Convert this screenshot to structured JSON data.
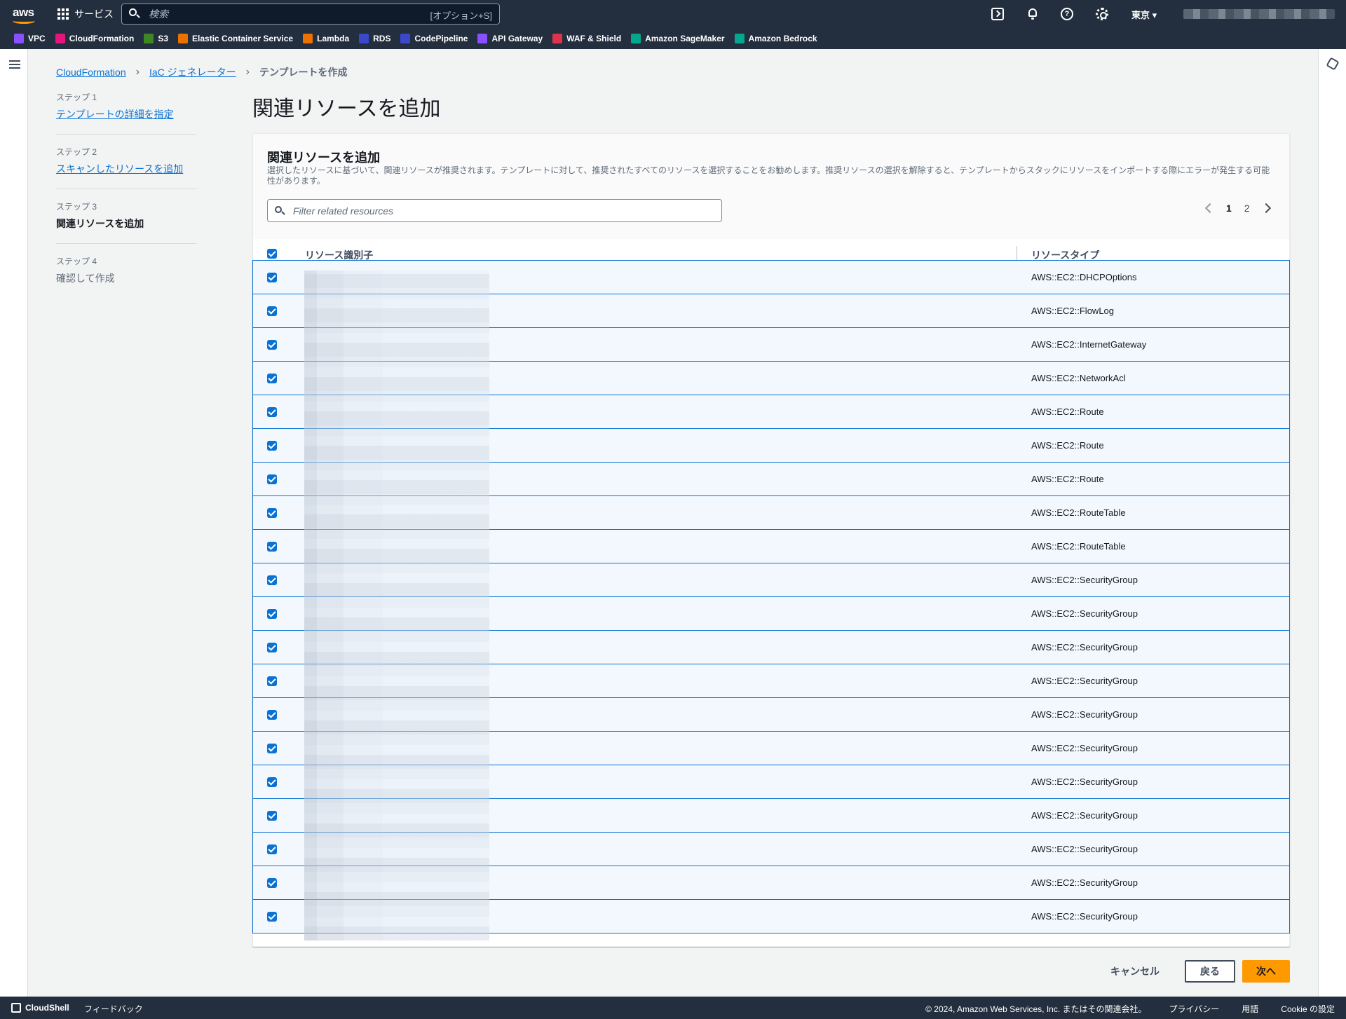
{
  "topnav": {
    "logo_text": "aws",
    "services_label": "サービス",
    "search_placeholder": "検索",
    "search_shortcut": "[オプション+S]",
    "region": "東京 ▾"
  },
  "favorites": [
    {
      "label": "VPC",
      "color": "#8c4fff"
    },
    {
      "label": "CloudFormation",
      "color": "#e7157b"
    },
    {
      "label": "S3",
      "color": "#3f8624"
    },
    {
      "label": "Elastic Container Service",
      "color": "#ed7100"
    },
    {
      "label": "Lambda",
      "color": "#ed7100"
    },
    {
      "label": "RDS",
      "color": "#3b48cc"
    },
    {
      "label": "CodePipeline",
      "color": "#3b48cc"
    },
    {
      "label": "API Gateway",
      "color": "#8c4fff"
    },
    {
      "label": "WAF & Shield",
      "color": "#dd344c"
    },
    {
      "label": "Amazon SageMaker",
      "color": "#01a88d"
    },
    {
      "label": "Amazon Bedrock",
      "color": "#01a88d"
    }
  ],
  "breadcrumb": {
    "items": [
      "CloudFormation",
      "IaC ジェネレーター"
    ],
    "current": "テンプレートを作成"
  },
  "steps": [
    {
      "label": "ステップ 1",
      "name": "テンプレートの詳細を指定",
      "state": "link"
    },
    {
      "label": "ステップ 2",
      "name": "スキャンしたリソースを追加",
      "state": "link"
    },
    {
      "label": "ステップ 3",
      "name": "関連リソースを追加",
      "state": "active"
    },
    {
      "label": "ステップ 4",
      "name": "確認して作成",
      "state": "disabled"
    }
  ],
  "page_title": "関連リソースを追加",
  "container": {
    "title": "関連リソースを追加",
    "description": "選択したリソースに基づいて、関連リソースが推奨されます。テンプレートに対して、推奨されたすべてのリソースを選択することをお勧めします。推奨リソースの選択を解除すると、テンプレートからスタックにリソースをインポートする際にエラーが発生する可能性があります。",
    "filter_placeholder": "Filter related resources",
    "pages": [
      "1",
      "2"
    ],
    "current_page": "1"
  },
  "table": {
    "col_identifier": "リソース識別子",
    "col_type": "リソースタイプ",
    "rows": [
      {
        "type": "AWS::EC2::DHCPOptions",
        "checked": true
      },
      {
        "type": "AWS::EC2::FlowLog",
        "checked": true
      },
      {
        "type": "AWS::EC2::InternetGateway",
        "checked": true
      },
      {
        "type": "AWS::EC2::NetworkAcl",
        "checked": true
      },
      {
        "type": "AWS::EC2::Route",
        "checked": true
      },
      {
        "type": "AWS::EC2::Route",
        "checked": true
      },
      {
        "type": "AWS::EC2::Route",
        "checked": true
      },
      {
        "type": "AWS::EC2::RouteTable",
        "checked": true
      },
      {
        "type": "AWS::EC2::RouteTable",
        "checked": true
      },
      {
        "type": "AWS::EC2::SecurityGroup",
        "checked": true
      },
      {
        "type": "AWS::EC2::SecurityGroup",
        "checked": true
      },
      {
        "type": "AWS::EC2::SecurityGroup",
        "checked": true
      },
      {
        "type": "AWS::EC2::SecurityGroup",
        "checked": true
      },
      {
        "type": "AWS::EC2::SecurityGroup",
        "checked": true
      },
      {
        "type": "AWS::EC2::SecurityGroup",
        "checked": true
      },
      {
        "type": "AWS::EC2::SecurityGroup",
        "checked": true
      },
      {
        "type": "AWS::EC2::SecurityGroup",
        "checked": true
      },
      {
        "type": "AWS::EC2::SecurityGroup",
        "checked": true
      },
      {
        "type": "AWS::EC2::SecurityGroup",
        "checked": true
      },
      {
        "type": "AWS::EC2::SecurityGroup",
        "checked": true
      }
    ]
  },
  "actions": {
    "cancel": "キャンセル",
    "back": "戻る",
    "next": "次へ"
  },
  "footer": {
    "cloudshell": "CloudShell",
    "feedback": "フィードバック",
    "copyright": "© 2024, Amazon Web Services, Inc. またはその関連会社。",
    "privacy": "プライバシー",
    "terms": "用語",
    "cookie": "Cookie の設定"
  }
}
